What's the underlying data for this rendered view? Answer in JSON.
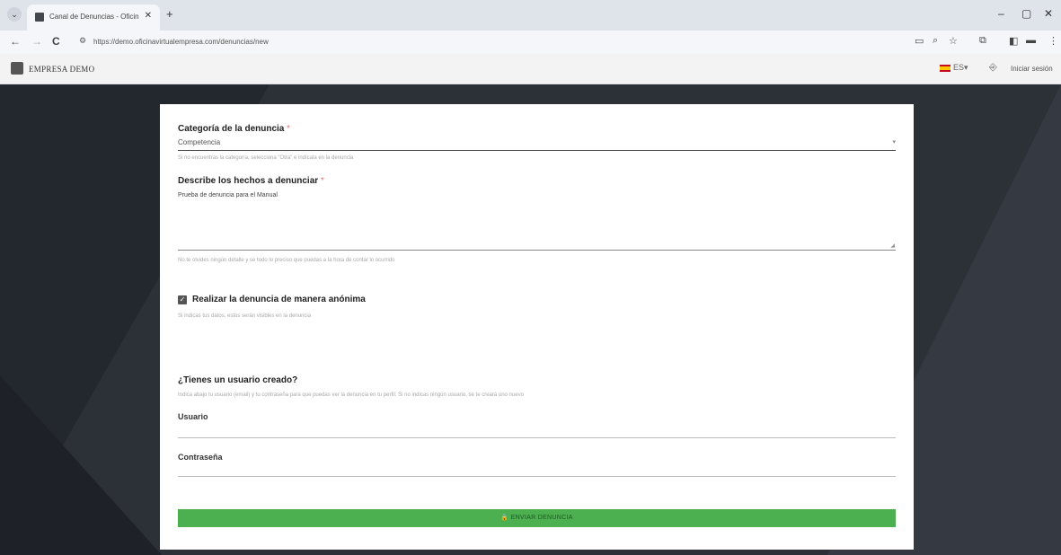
{
  "browser": {
    "tab_title": "Canal de Denuncias - Oficina V",
    "tab_close": "✕",
    "new_tab": "+",
    "menu_glyph": "⌄",
    "url": "https://demo.oficinavirtualempresa.com/denuncias/new",
    "nav": {
      "back": "←",
      "forward": "→",
      "reload": "C"
    },
    "window_controls": {
      "minimize": "–",
      "maximize": "▢",
      "close": "✕"
    },
    "toolbar_icons": [
      "screen-icon",
      "zoom-icon",
      "star-icon",
      "extensions-icon",
      "sidebar-icon",
      "profile-icon",
      "menu-icon"
    ]
  },
  "header": {
    "company": "EMPRESA DEMO",
    "language": "ES",
    "language_caret": "▾",
    "login_label": "Iniciar sesión"
  },
  "form": {
    "category": {
      "label": "Categoría de la denuncia",
      "required_mark": "*",
      "value": "Competencia",
      "hint": "Si no encuentras la categoría, selecciona \"Otra\" e indícala en la denuncia"
    },
    "description": {
      "label": "Describe los hechos a denunciar",
      "required_mark": "*",
      "value": "Prueba de denuncia para el Manual",
      "hint": "No te olvides ningún detalle y se todo lo preciso que puedas a la hora de contar lo ocurrido"
    },
    "anonymous": {
      "label": "Realizar la denuncia de manera anónima",
      "checked": true,
      "hint": "Si indicas tus datos, estos serán visibles en la denuncia"
    },
    "account": {
      "title": "¿Tienes un usuario creado?",
      "hint": "Indica abajo tu usuario (email) y tu contraseña para que puedas ver la denuncia en tu perfil. Si no indicas ningún usuario, se te creará uno nuevo",
      "username_label": "Usuario",
      "password_label": "Contraseña"
    },
    "submit_label": "ENVIAR DENUNCIA",
    "submit_icon": "🔒"
  },
  "colors": {
    "submit_bg": "#4caf50",
    "required": "#e57373",
    "background": "#2c3037"
  }
}
